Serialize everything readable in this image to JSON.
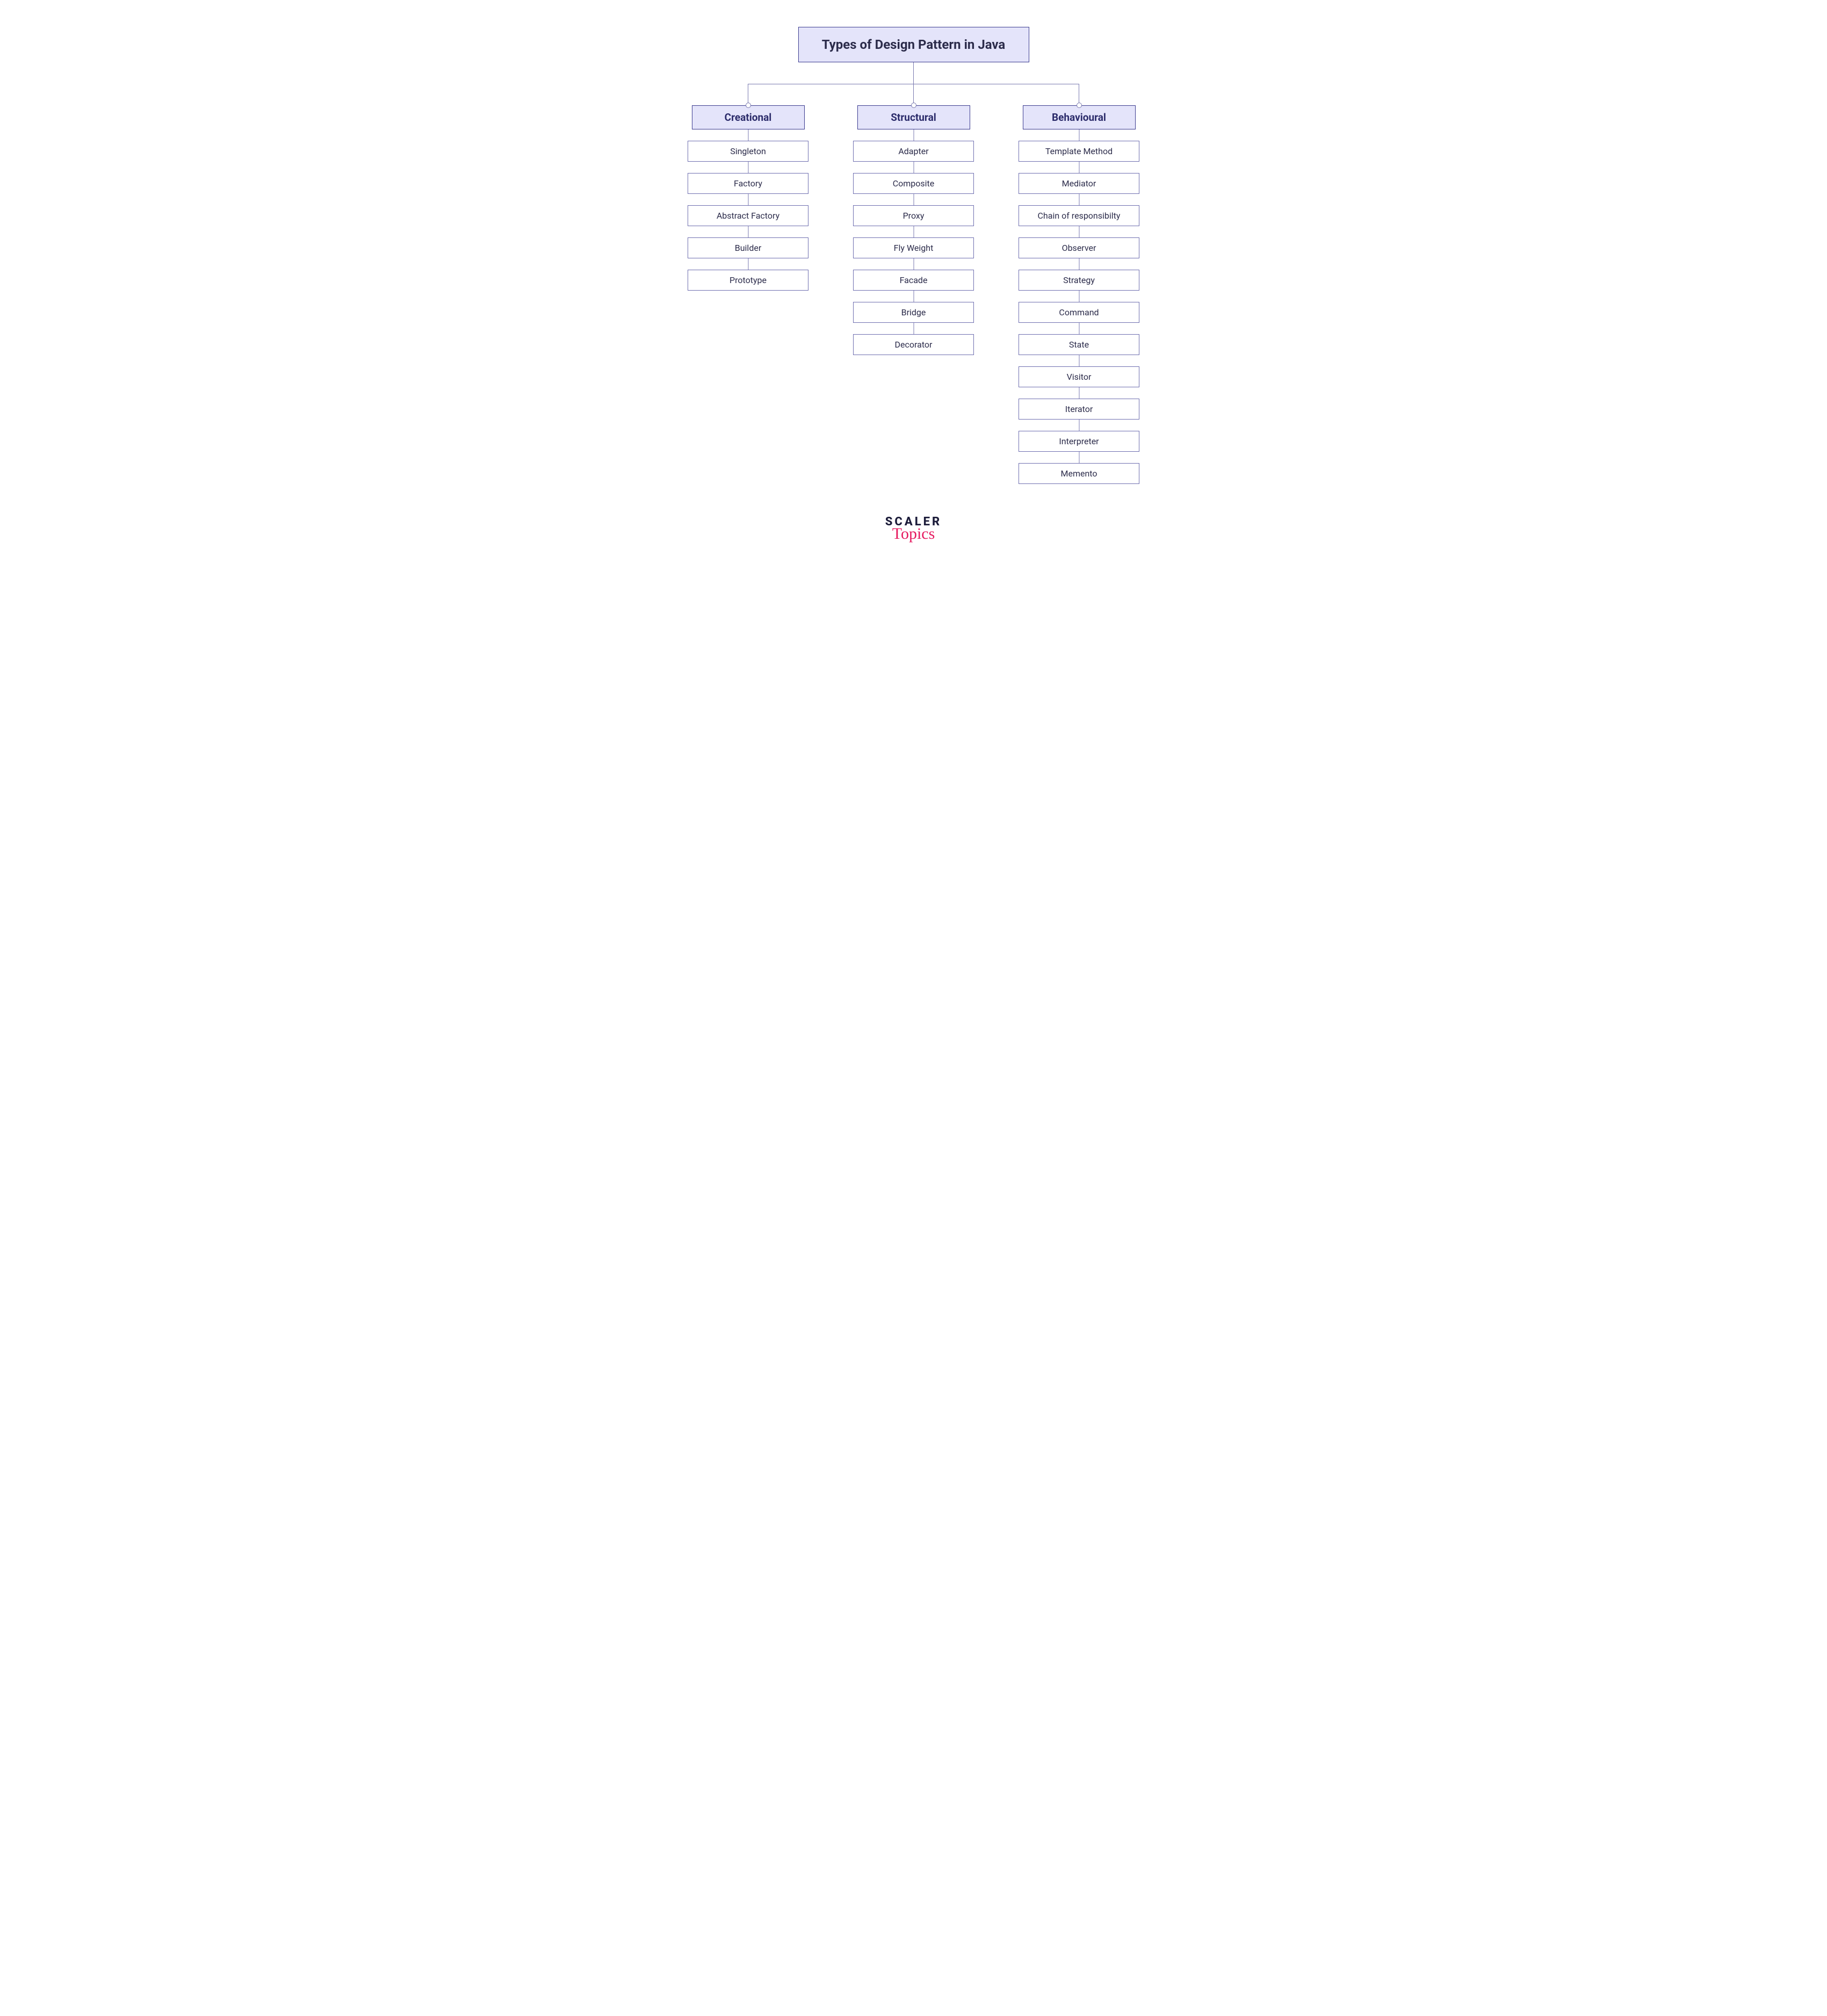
{
  "title": "Types of Design Pattern in Java",
  "categories": [
    {
      "name": "Creational",
      "items": [
        "Singleton",
        "Factory",
        "Abstract Factory",
        "Builder",
        "Prototype"
      ]
    },
    {
      "name": "Structural",
      "items": [
        "Adapter",
        "Composite",
        "Proxy",
        "Fly Weight",
        "Facade",
        "Bridge",
        "Decorator"
      ]
    },
    {
      "name": "Behavioural",
      "items": [
        "Template Method",
        "Mediator",
        "Chain of responsibilty",
        "Observer",
        "Strategy",
        "Command",
        "State",
        "Visitor",
        "Iterator",
        "Interpreter",
        "Memento"
      ]
    }
  ],
  "logo": {
    "line1": "SCALER",
    "line2": "Topics"
  },
  "colors": {
    "box_fill": "#e4e4fa",
    "box_border": "#3b3b8f",
    "item_border": "#6f6fb0",
    "line": "#7a7ab0",
    "text": "#2b2b4a",
    "logo_accent": "#e6195f"
  }
}
